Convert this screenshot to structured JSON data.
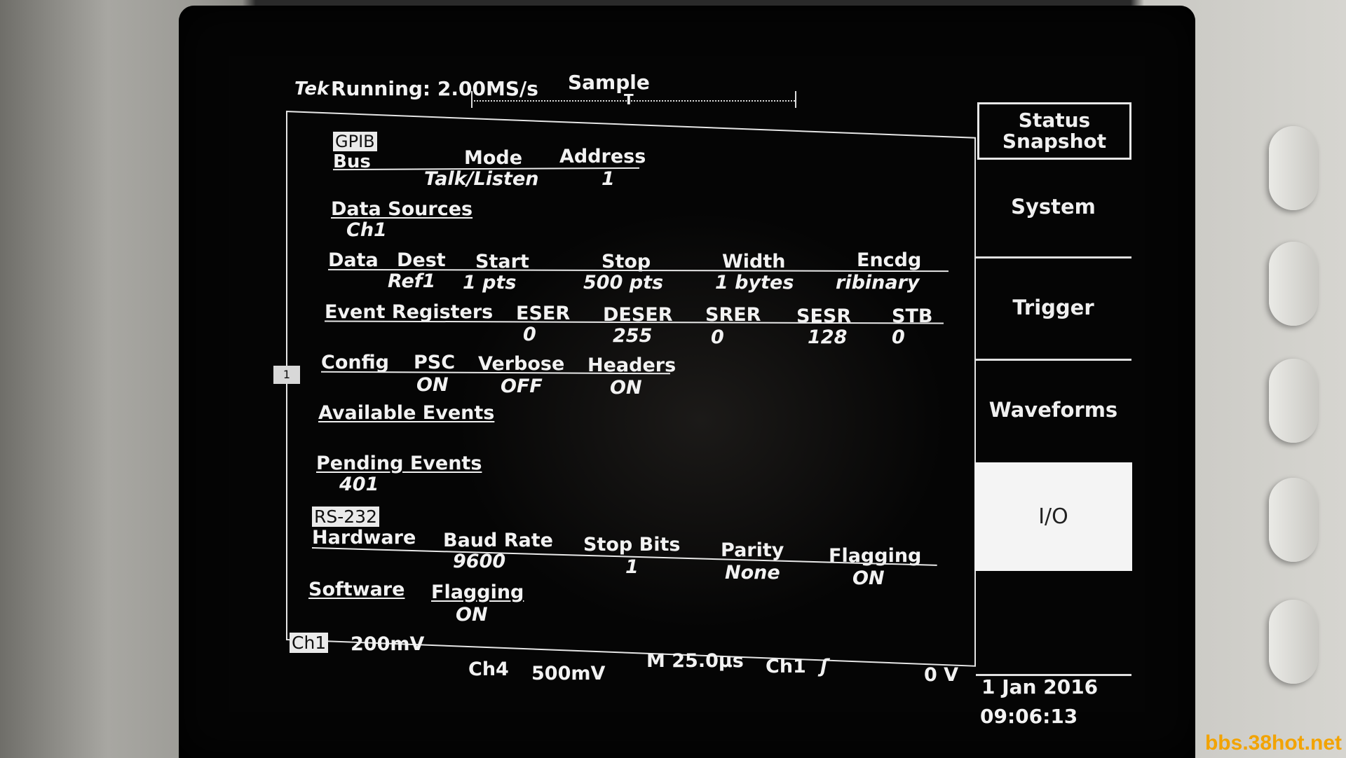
{
  "header": {
    "brand": "Tek",
    "status": "Running: 2.00MS/s",
    "acq_mode": "Sample"
  },
  "gpib": {
    "section_label": "GPIB",
    "bus_label": "Bus",
    "mode_label": "Mode",
    "address_label": "Address",
    "mode_value": "Talk/Listen",
    "address_value": "1"
  },
  "data_sources": {
    "label": "Data Sources",
    "value": "Ch1"
  },
  "data": {
    "label": "Data",
    "dest_label": "Dest",
    "start_label": "Start",
    "stop_label": "Stop",
    "width_label": "Width",
    "encdg_label": "Encdg",
    "dest_value": "Ref1",
    "start_value": "1 pts",
    "stop_value": "500 pts",
    "width_value": "1 bytes",
    "encdg_value": "ribinary"
  },
  "event_registers": {
    "label": "Event Registers",
    "eser_label": "ESER",
    "deser_label": "DESER",
    "srer_label": "SRER",
    "sesr_label": "SESR",
    "stb_label": "STB",
    "eser_value": "0",
    "deser_value": "255",
    "srer_value": "0",
    "sesr_value": "128",
    "stb_value": "0"
  },
  "config": {
    "label": "Config",
    "psc_label": "PSC",
    "verbose_label": "Verbose",
    "headers_label": "Headers",
    "psc_value": "ON",
    "verbose_value": "OFF",
    "headers_value": "ON"
  },
  "available_events": {
    "label": "Available Events"
  },
  "pending_events": {
    "label": "Pending Events",
    "value": "401"
  },
  "rs232": {
    "section_label": "RS-232",
    "hardware_label": "Hardware",
    "baud_label": "Baud Rate",
    "stopbits_label": "Stop Bits",
    "parity_label": "Parity",
    "flagging_label": "Flagging",
    "baud_value": "9600",
    "stopbits_value": "1",
    "parity_value": "None",
    "flagging_value": "ON",
    "software_label": "Software",
    "sw_flagging_label": "Flagging",
    "sw_flagging_value": "ON"
  },
  "footer": {
    "ch1_label": "Ch1",
    "ch1_scale": "200mV",
    "ch4_label": "Ch4",
    "ch4_scale": "500mV",
    "timebase": "M 25.0µs",
    "trigger_source": "Ch1",
    "trigger_slope_glyph": "ʃ",
    "trigger_level": "0 V",
    "date": "1 Jan 2016",
    "time": "09:06:13"
  },
  "menu": {
    "status_snapshot": "Status Snapshot",
    "system": "System",
    "trigger": "Trigger",
    "waveforms": "Waveforms",
    "io": "I/O"
  },
  "ground_marker": "1",
  "watermark": "bbs.38hot.net"
}
